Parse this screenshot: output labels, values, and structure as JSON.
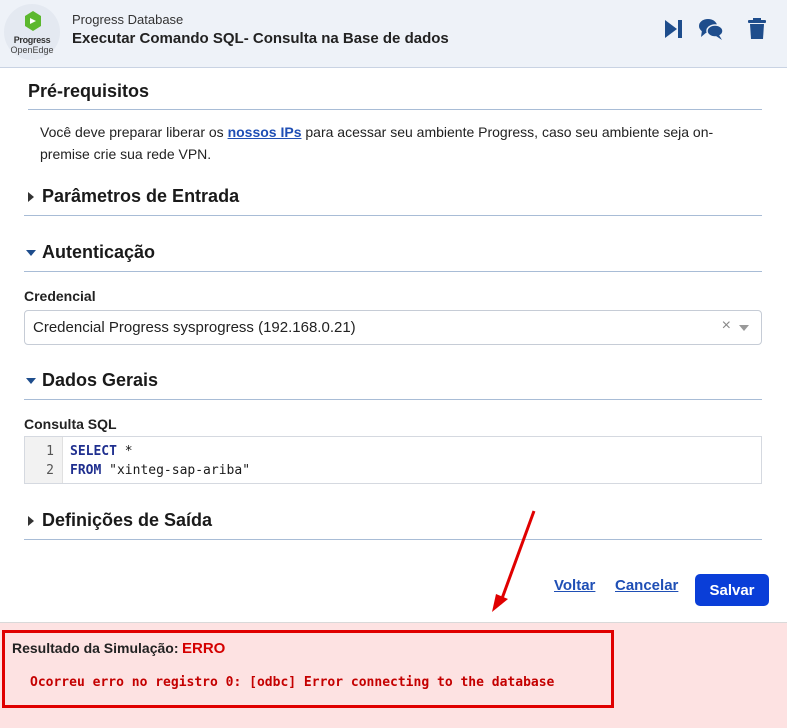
{
  "header": {
    "logo_line1": "Progress",
    "logo_line2": "OpenEdge",
    "app_name": "Progress Database",
    "title": "Executar Comando SQL- Consulta na Base de dados",
    "icons": [
      "skip-forward-icon",
      "chat-icon",
      "trash-icon"
    ],
    "accent_color": "#1e4d8c"
  },
  "prereq": {
    "title": "Pré-requisitos",
    "text_before": "Você deve preparar liberar os ",
    "link": "nossos IPs",
    "text_after": " para acessar seu ambiente Progress, caso seu ambiente seja on-premise crie sua rede VPN."
  },
  "sections": {
    "input_params": "Parâmetros de Entrada",
    "auth": "Autenticação",
    "general": "Dados Gerais",
    "output": "Definições de Saída"
  },
  "auth": {
    "credential_label": "Credencial",
    "credential_value": "Credencial Progress sysprogress (192.168.0.21)",
    "clear_symbol": "×"
  },
  "general": {
    "sql_label": "Consulta SQL",
    "lines": [
      {
        "n": "1",
        "kw": "SELECT",
        "rest": " *"
      },
      {
        "n": "2",
        "kw": "FROM",
        "rest": " \"xinteg-sap-ariba\""
      }
    ]
  },
  "actions": {
    "back": "Voltar",
    "cancel": "Cancelar",
    "save": "Salvar",
    "save_color": "#0a3ed8"
  },
  "result": {
    "label": "Resultado da Simulação:",
    "status": "ERRO",
    "message": "Ocorreu erro no registro 0: [odbc] Error connecting to the database",
    "error_color": "#e00000"
  }
}
